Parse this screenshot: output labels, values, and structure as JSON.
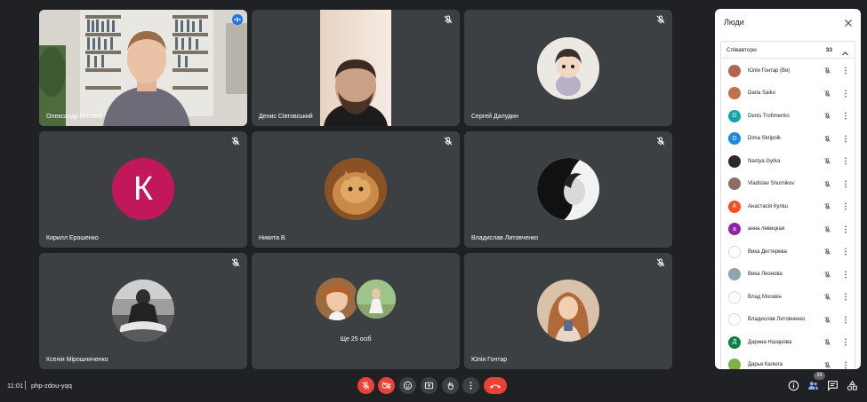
{
  "tiles": [
    {
      "name": "Олександр Кєссаєв",
      "muted": false,
      "active": true
    },
    {
      "name": "Денис Сівтовський",
      "muted": true
    },
    {
      "name": "Сергей Далудин",
      "muted": true
    },
    {
      "name": "Кирилл Ерошенко",
      "muted": true,
      "avatar_letter": "К",
      "avatar_color": "#c2185b"
    },
    {
      "name": "Никита В.",
      "muted": true
    },
    {
      "name": "Владислав Литовченко",
      "muted": true
    },
    {
      "name": "Ксенія Мірошниченко",
      "muted": true
    },
    {
      "more_label": "Ще 25 осіб"
    },
    {
      "name": "Юлія Гонтар",
      "muted": true
    }
  ],
  "panel": {
    "title": "Люди",
    "section_label": "Співавтори",
    "count": "33",
    "participants": [
      {
        "name": "Юлія Гонтар (Ви)",
        "color": "#b5654a",
        "letter": ""
      },
      {
        "name": "Daria Saiko",
        "color": "#c0704a",
        "letter": ""
      },
      {
        "name": "Denis Trofimenko",
        "color": "#12a4a8",
        "letter": "D"
      },
      {
        "name": "Dima Skripnik",
        "color": "#1e88e5",
        "letter": "D"
      },
      {
        "name": "Nastya Gyrka",
        "color": "#2b2b2b",
        "letter": ""
      },
      {
        "name": "Vladislav Snurnikov",
        "color": "#8d6e63",
        "letter": ""
      },
      {
        "name": "Анастасія Куліш",
        "color": "#f4511e",
        "letter": "А"
      },
      {
        "name": "анна левицкая",
        "color": "#8e24aa",
        "letter": "а"
      },
      {
        "name": "Вика Дегтерева",
        "color": "#ffffff",
        "letter": ""
      },
      {
        "name": "Вика Леонова",
        "color": "#90a4ae",
        "letter": ""
      },
      {
        "name": "Влад Москвін",
        "color": "#ffffff",
        "letter": ""
      },
      {
        "name": "Владислав Литовченко",
        "color": "#ffffff",
        "letter": ""
      },
      {
        "name": "Дарина Назарова",
        "color": "#0b8043",
        "letter": "Д"
      },
      {
        "name": "Дарья Калюга",
        "color": "#7cb342",
        "letter": ""
      }
    ]
  },
  "bottom": {
    "time": "11:01",
    "meeting_code": "php-zdou-yqq",
    "people_badge": "33"
  },
  "colors": {
    "accent": "#8ab4f8",
    "end_call": "#ea4335",
    "tile_bg": "#3c4043"
  }
}
